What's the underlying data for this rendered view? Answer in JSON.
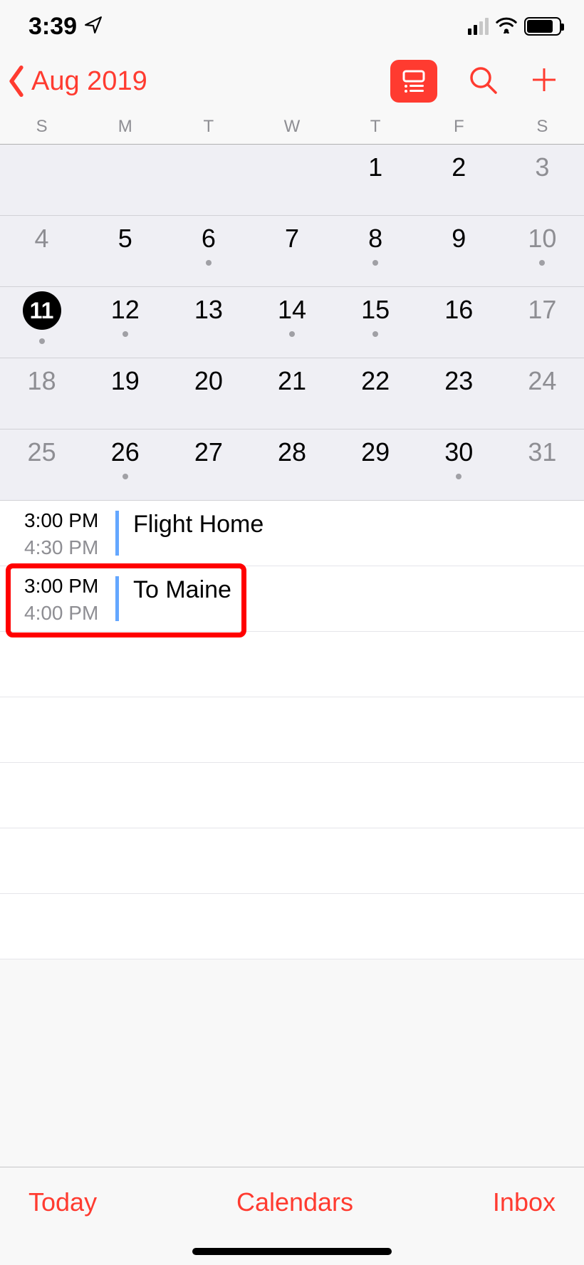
{
  "status": {
    "time": "3:39",
    "location_icon": "location-arrow",
    "signal_bars": 2,
    "wifi": true,
    "battery_pct": 75
  },
  "nav": {
    "back_label": "Aug 2019"
  },
  "week_days": [
    "S",
    "M",
    "T",
    "W",
    "T",
    "F",
    "S"
  ],
  "month_grid": [
    [
      {
        "num": "",
        "weekend": false,
        "dot": false
      },
      {
        "num": "",
        "weekend": false,
        "dot": false
      },
      {
        "num": "",
        "weekend": false,
        "dot": false
      },
      {
        "num": "",
        "weekend": false,
        "dot": false
      },
      {
        "num": "1",
        "weekend": false,
        "dot": false
      },
      {
        "num": "2",
        "weekend": false,
        "dot": false
      },
      {
        "num": "3",
        "weekend": true,
        "dot": false
      }
    ],
    [
      {
        "num": "4",
        "weekend": true,
        "dot": false
      },
      {
        "num": "5",
        "weekend": false,
        "dot": false
      },
      {
        "num": "6",
        "weekend": false,
        "dot": true
      },
      {
        "num": "7",
        "weekend": false,
        "dot": false
      },
      {
        "num": "8",
        "weekend": false,
        "dot": true
      },
      {
        "num": "9",
        "weekend": false,
        "dot": false
      },
      {
        "num": "10",
        "weekend": true,
        "dot": true
      }
    ],
    [
      {
        "num": "11",
        "weekend": true,
        "dot": true,
        "selected": true
      },
      {
        "num": "12",
        "weekend": false,
        "dot": true
      },
      {
        "num": "13",
        "weekend": false,
        "dot": false
      },
      {
        "num": "14",
        "weekend": false,
        "dot": true
      },
      {
        "num": "15",
        "weekend": false,
        "dot": true
      },
      {
        "num": "16",
        "weekend": false,
        "dot": false
      },
      {
        "num": "17",
        "weekend": true,
        "dot": false
      }
    ],
    [
      {
        "num": "18",
        "weekend": true,
        "dot": false
      },
      {
        "num": "19",
        "weekend": false,
        "dot": false
      },
      {
        "num": "20",
        "weekend": false,
        "dot": false
      },
      {
        "num": "21",
        "weekend": false,
        "dot": false
      },
      {
        "num": "22",
        "weekend": false,
        "dot": false
      },
      {
        "num": "23",
        "weekend": false,
        "dot": false
      },
      {
        "num": "24",
        "weekend": true,
        "dot": false
      }
    ],
    [
      {
        "num": "25",
        "weekend": true,
        "dot": false
      },
      {
        "num": "26",
        "weekend": false,
        "dot": true
      },
      {
        "num": "27",
        "weekend": false,
        "dot": false
      },
      {
        "num": "28",
        "weekend": false,
        "dot": false
      },
      {
        "num": "29",
        "weekend": false,
        "dot": false
      },
      {
        "num": "30",
        "weekend": false,
        "dot": true
      },
      {
        "num": "31",
        "weekend": true,
        "dot": false
      }
    ]
  ],
  "events": [
    {
      "start": "3:00 PM",
      "end": "4:30 PM",
      "title": "Flight Home",
      "highlighted": false
    },
    {
      "start": "3:00 PM",
      "end": "4:00 PM",
      "title": "To Maine",
      "highlighted": true
    }
  ],
  "toolbar": {
    "today": "Today",
    "calendars": "Calendars",
    "inbox": "Inbox"
  },
  "colors": {
    "accent": "#ff3b30",
    "event_bar": "#64a7ff"
  }
}
